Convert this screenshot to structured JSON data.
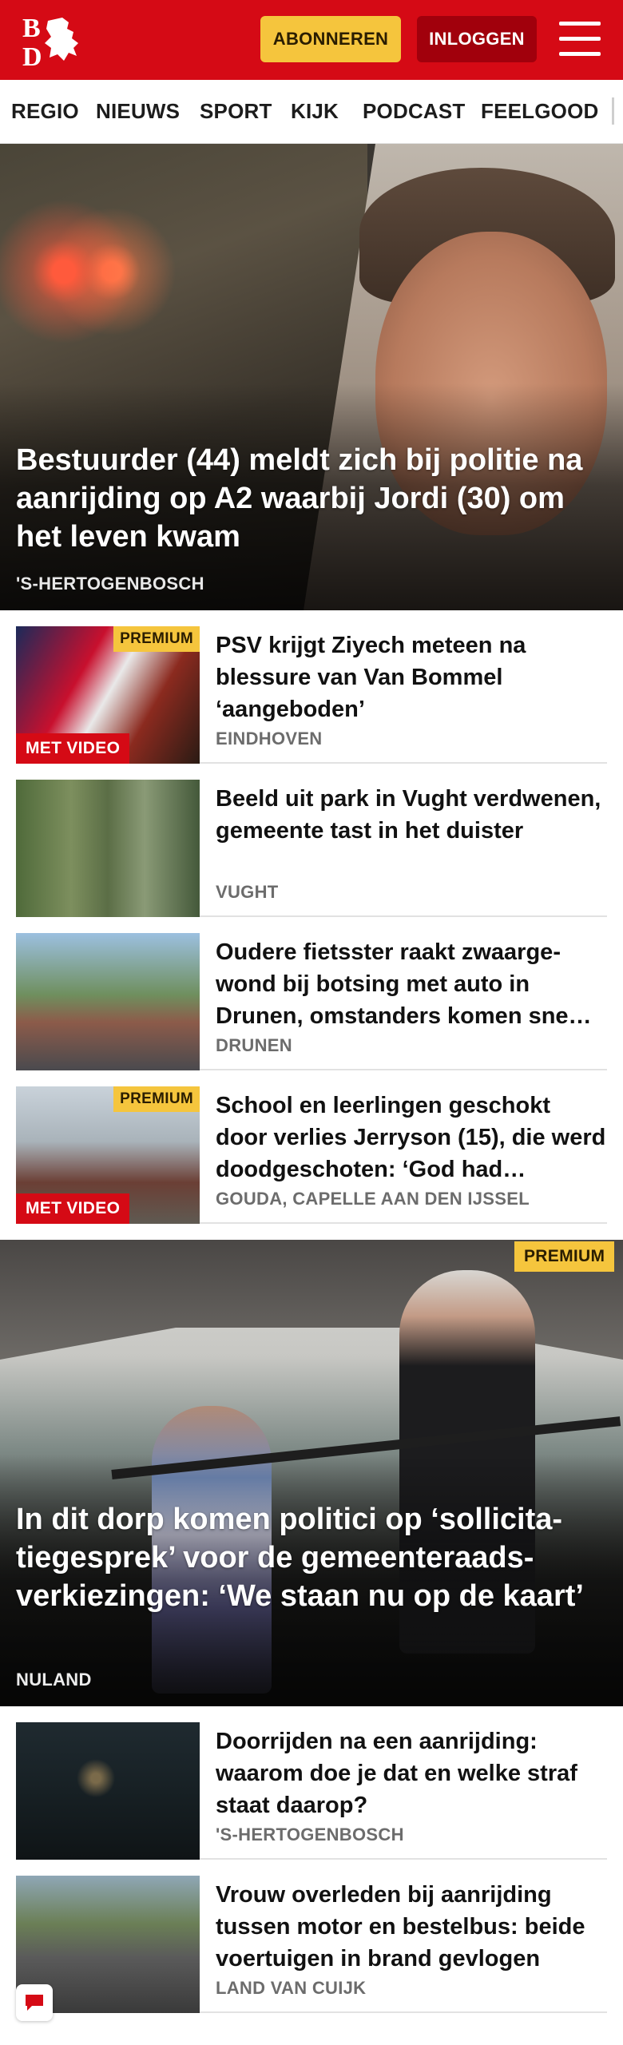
{
  "header": {
    "logo_text": "BD",
    "subscribe_label": "ABONNEREN",
    "login_label": "INLOGGEN"
  },
  "nav": {
    "items": [
      "REGIO",
      "NIEUWS",
      "SPORT",
      "KIJK",
      "PODCAST",
      "FEELGOOD"
    ]
  },
  "hero": {
    "title": "Bestuurder (44) meldt zich bij politie na aanrijding op A2 waarbij Jordi (30) om het leven kwam",
    "location": "'S-HERTOGENBOSCH"
  },
  "articles": [
    {
      "title": "PSV krijgt Ziyech meteen na blessure van Van Bommel ‘aangeboden’",
      "location": "EINDHOVEN",
      "premium": "PREMIUM",
      "video": "MET VIDEO"
    },
    {
      "title": "Beeld uit park in Vught verdwenen, gemeente tast in het duister",
      "location": "VUGHT"
    },
    {
      "title": "Oudere fietsster raakt zwaarge­wond bij botsing met auto in Drunen, omstanders komen sne…",
      "location": "DRUNEN"
    },
    {
      "title": "School en leerlingen geschokt door verlies Jerryson (15), die werd doodgeschoten: ‘God had…",
      "location": "GOUDA, CAPELLE AAN DEN IJSSEL",
      "premium": "PREMIUM",
      "video": "MET VIDEO"
    }
  ],
  "hero2": {
    "title": "In dit dorp komen politici op ‘sollicita­tiegesprek’ voor de gemeenteraads­verkiezingen: ‘We staan nu op de kaart’",
    "location": "NULAND",
    "premium": "PREMIUM"
  },
  "articles2": [
    {
      "title": "Doorrijden na een aanrijding: waarom doe je dat en welke straf staat daarop?",
      "location": "'S-HERTOGENBOSCH"
    },
    {
      "title": "Vrouw overleden bij aanrijding tussen motor en bestelbus: beide voertuigen in brand gevlogen",
      "location": "LAND VAN CUIJK"
    }
  ],
  "colors": {
    "brand_red": "#d50a15",
    "premium_yellow": "#f5c53d",
    "login_dark_red": "#a1000c"
  },
  "icons": {
    "logo": "lion-crest-logo",
    "menu": "hamburger-menu-icon",
    "feedback": "chat-bubble-icon"
  }
}
